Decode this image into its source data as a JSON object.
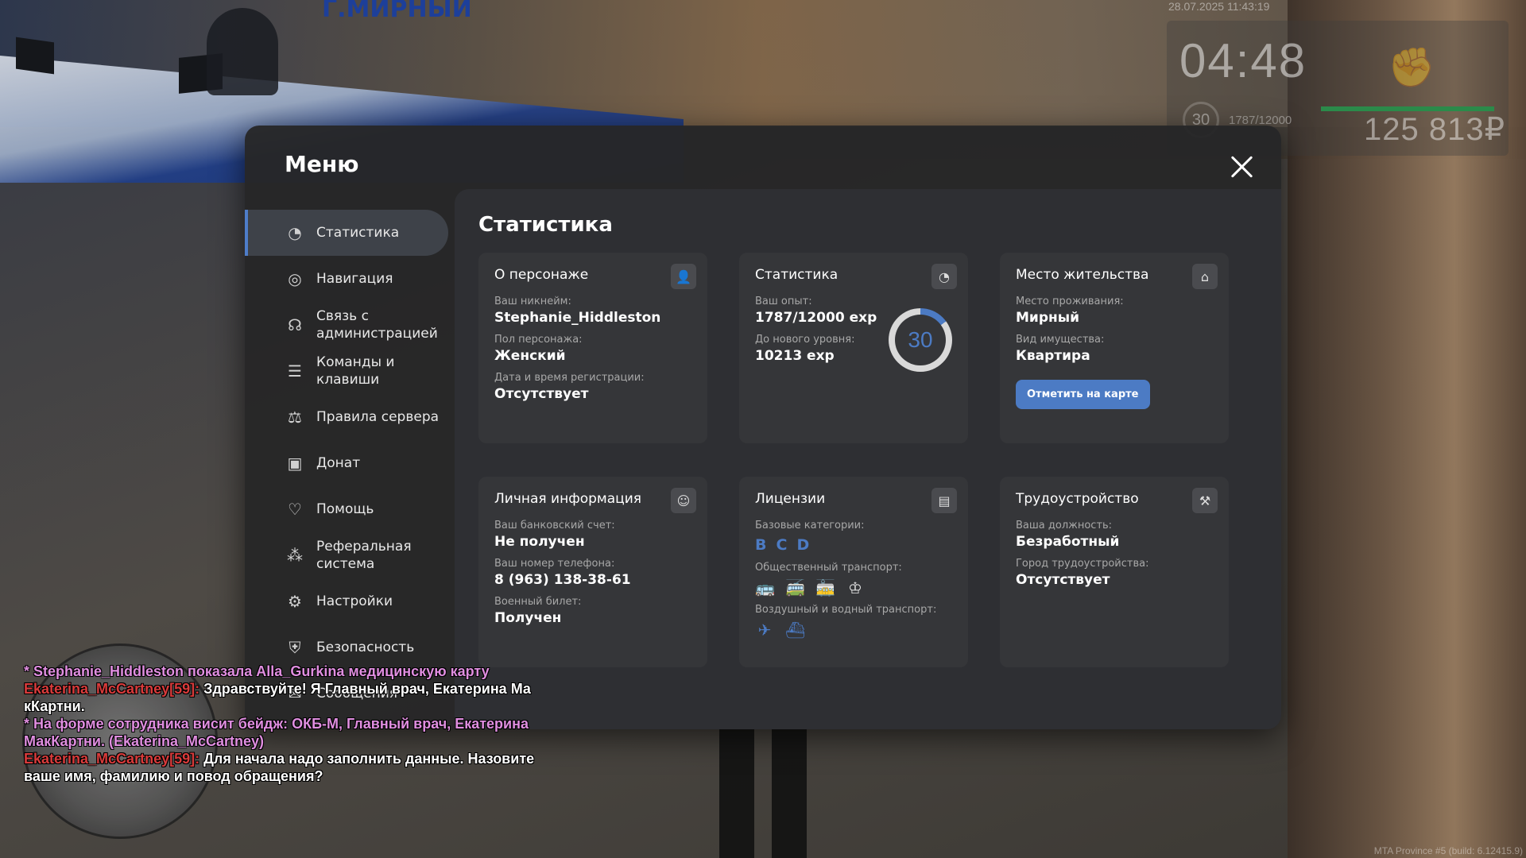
{
  "hud": {
    "datetime": "28.07.2025 11:43:19",
    "time": "04:48",
    "level": "30",
    "exp": "1787/12000",
    "money": "125 813₽",
    "health_percent": 100,
    "build": "MTA Province #5 (build: 6.12415.9)"
  },
  "background": {
    "sign": "Г.МИРНЫЙ"
  },
  "menu": {
    "title": "Меню",
    "nav": [
      {
        "label": "Статистика",
        "icon": "pie-chart-icon"
      },
      {
        "label": "Навигация",
        "icon": "compass-icon"
      },
      {
        "label": "Связь с администрацией",
        "icon": "headset-icon"
      },
      {
        "label": "Команды и клавиши",
        "icon": "document-list-icon"
      },
      {
        "label": "Правила сервера",
        "icon": "scales-icon"
      },
      {
        "label": "Донат",
        "icon": "wallet-icon"
      },
      {
        "label": "Помощь",
        "icon": "heart-hand-icon"
      },
      {
        "label": "Реферальная система",
        "icon": "people-network-icon"
      },
      {
        "label": "Настройки",
        "icon": "gear-icon"
      },
      {
        "label": "Безопасность",
        "icon": "shield-icon"
      },
      {
        "label": "Сообщения",
        "icon": "message-icon"
      }
    ]
  },
  "stats": {
    "title": "Статистика",
    "character": {
      "title": "О персонаже",
      "nickname_label": "Ваш никнейм:",
      "nickname": "Stephanie_Hiddleston",
      "gender_label": "Пол персонажа:",
      "gender": "Женский",
      "reg_label": "Дата и время регистрации:",
      "reg": "Отсутствует"
    },
    "statistics": {
      "title": "Статистика",
      "exp_label": "Ваш опыт:",
      "exp": "1787/12000 exp",
      "next_label": "До нового уровня:",
      "next": "10213 exp",
      "level": "30",
      "progress_fraction": 0.149
    },
    "residence": {
      "title": "Место жительства",
      "place_label": "Место проживания:",
      "place": "Мирный",
      "property_label": "Вид имущества:",
      "property": "Квартира",
      "button": "Отметить на карте"
    },
    "personal": {
      "title": "Личная информация",
      "bank_label": "Ваш банковский счет:",
      "bank": "Не получен",
      "phone_label": "Ваш номер телефона:",
      "phone": "8 (963) 138-38-61",
      "military_label": "Военный билет:",
      "military": "Получен"
    },
    "licenses": {
      "title": "Лицензии",
      "base_label": "Базовые категории:",
      "categories": [
        "B",
        "C",
        "D"
      ],
      "public_label": "Общественный транспорт:",
      "public_icons": [
        "bus-icon",
        "trolleybus-icon",
        "tram-icon",
        "taxi-driver-icon"
      ],
      "air_label": "Воздушный и водный транспорт:",
      "air_icons": [
        "airplane-icon",
        "boat-icon"
      ]
    },
    "employment": {
      "title": "Трудоустройство",
      "position_label": "Ваша должность:",
      "position": "Безработный",
      "city_label": "Город трудоустройства:",
      "city": "Отсутствует"
    }
  },
  "chat": [
    {
      "parts": [
        {
          "c": "pink",
          "t": "* Stephanie_Hiddleston показала Alla_Gurkina медицинскую карту"
        }
      ]
    },
    {
      "parts": [
        {
          "c": "red",
          "t": "Ekaterina_McCartney[59]: "
        },
        {
          "c": "white",
          "t": "Здравствуйте! Я Главный врач, Екатерина Ма"
        }
      ]
    },
    {
      "parts": [
        {
          "c": "white",
          "t": "кКартни."
        }
      ]
    },
    {
      "parts": [
        {
          "c": "pink",
          "t": "* На форме сотрудника висит бейдж: ОКБ-М, Главный врач, Екатерина"
        }
      ]
    },
    {
      "parts": [
        {
          "c": "pink",
          "t": " МакКартни. (Ekaterina_McCartney)"
        }
      ]
    },
    {
      "parts": [
        {
          "c": "red",
          "t": "Ekaterina_McCartney[59]: "
        },
        {
          "c": "white",
          "t": "Для начала надо заполнить данные. Назовите"
        }
      ]
    },
    {
      "parts": [
        {
          "c": "white",
          "t": " ваше имя, фамилию и повод обращения?"
        }
      ]
    }
  ]
}
